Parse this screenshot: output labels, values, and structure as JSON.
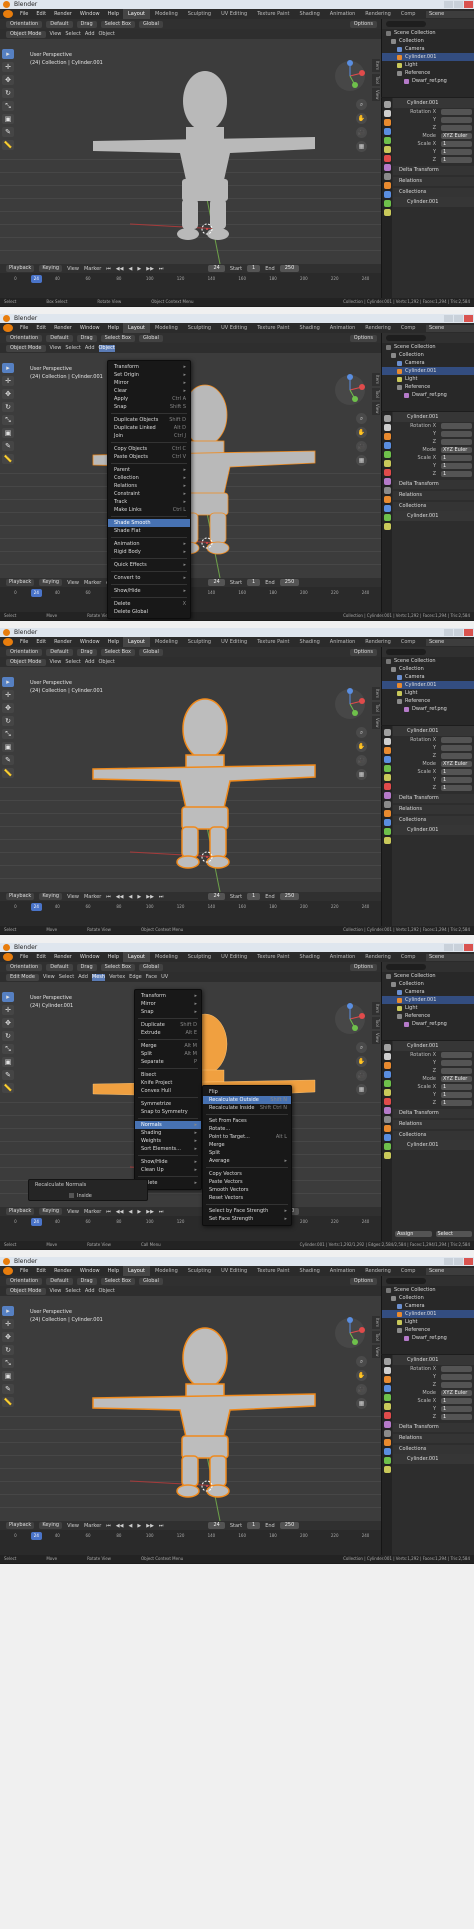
{
  "app": {
    "title": "Blender"
  },
  "menubar": {
    "items": [
      "File",
      "Edit",
      "Render",
      "Window",
      "Help"
    ],
    "workspaces": [
      "Layout",
      "Modeling",
      "Sculpting",
      "UV Editing",
      "Texture Paint",
      "Shading",
      "Animation",
      "Rendering",
      "Comp"
    ],
    "scene": "Scene"
  },
  "header": {
    "mode_object": "Object Mode",
    "mode_edit": "Edit Mode",
    "view": "View",
    "select": "Select",
    "add": "Add",
    "object": "Object",
    "mesh": "Mesh",
    "vertex": "Vertex",
    "edge": "Edge",
    "face": "Face",
    "uv": "UV",
    "orientation": "Orientation",
    "default": "Default",
    "drag": "Drag",
    "select_box": "Select Box",
    "global": "Global",
    "options": "Options"
  },
  "viewport": {
    "line1": "User Perspective",
    "line2": "(24) Collection | Cylinder.001",
    "line2_edit": "(24) Cylinder.001"
  },
  "sidetabs": [
    "Item",
    "Tool",
    "View"
  ],
  "timeline": {
    "playback": "Playback",
    "keying": "Keying",
    "view": "View",
    "marker": "Marker",
    "current": "24",
    "start_label": "Start",
    "start": "1",
    "end_label": "End",
    "end": "250",
    "ruler": [
      "0",
      "20",
      "40",
      "60",
      "80",
      "100",
      "120",
      "140",
      "160",
      "180",
      "200",
      "220",
      "240"
    ]
  },
  "status": {
    "s1": {
      "left": "Select",
      "mid1": "Box Select",
      "mid2": "Rotate View",
      "mid3": "Object Context Menu",
      "stats": "Collection | Cylinder.001 | Verts:1,292 | Faces:1,294 | Tris:2,584"
    },
    "s2": {
      "left": "Select",
      "mid1": "Move",
      "mid2": "Rotate View",
      "mid3": "Object Context Menu",
      "stats": "Collection | Cylinder.001 | Verts:1,292 | Faces:1,294 | Tris:2,584"
    },
    "s4": {
      "left": "Select",
      "mid1": "Move",
      "mid2": "Rotate View",
      "mid3": "Call Menu",
      "stats": "Cylinder.001 | Verts:1,292/1,292 | Edges:2,584/2,584 | Faces:1,294/1,294 | Tris:2,584"
    }
  },
  "outliner": {
    "rows": [
      "Scene Collection",
      "Collection",
      "Camera",
      "Cylinder.001",
      "Light",
      "Reference",
      "Dwarf_ref.png"
    ]
  },
  "properties": {
    "object_name": "Cylinder.001",
    "rows": [
      {
        "l": "Rotation X",
        "v": ""
      },
      {
        "l": "Y",
        "v": ""
      },
      {
        "l": "Z",
        "v": ""
      },
      {
        "l": "Mode",
        "v": "XYZ Euler"
      },
      {
        "l": "Scale X",
        "v": "1"
      },
      {
        "l": "Y",
        "v": "1"
      },
      {
        "l": "Z",
        "v": "1"
      }
    ],
    "delta": "Delta Transform",
    "relations": "Relations",
    "collections": "Collections",
    "obj2": "Cylinder.001",
    "assign": "Assign",
    "select": "Select"
  },
  "object_menu": {
    "items": [
      {
        "t": "Transform",
        "sc": "▸"
      },
      {
        "t": "Set Origin",
        "sc": "▸"
      },
      {
        "t": "Mirror",
        "sc": "▸"
      },
      {
        "t": "Clear",
        "sc": "▸"
      },
      {
        "t": "Apply",
        "sc": "Ctrl A"
      },
      {
        "t": "Snap",
        "sc": "Shift S"
      },
      {
        "sep": true
      },
      {
        "t": "Duplicate Objects",
        "sc": "Shift D"
      },
      {
        "t": "Duplicate Linked",
        "sc": "Alt D"
      },
      {
        "t": "Join",
        "sc": "Ctrl J"
      },
      {
        "sep": true
      },
      {
        "t": "Copy Objects",
        "sc": "Ctrl C"
      },
      {
        "t": "Paste Objects",
        "sc": "Ctrl V"
      },
      {
        "sep": true
      },
      {
        "t": "Parent",
        "sc": "▸"
      },
      {
        "t": "Collection",
        "sc": "▸"
      },
      {
        "t": "Relations",
        "sc": "▸"
      },
      {
        "t": "Constraint",
        "sc": "▸"
      },
      {
        "t": "Track",
        "sc": "▸"
      },
      {
        "t": "Make Links",
        "sc": "Ctrl L"
      },
      {
        "sep": true
      },
      {
        "t": "Shade Smooth",
        "sc": "",
        "hl": true
      },
      {
        "t": "Shade Flat",
        "sc": ""
      },
      {
        "sep": true
      },
      {
        "t": "Animation",
        "sc": "▸"
      },
      {
        "t": "Rigid Body",
        "sc": "▸"
      },
      {
        "sep": true
      },
      {
        "t": "Quick Effects",
        "sc": "▸"
      },
      {
        "sep": true
      },
      {
        "t": "Convert to",
        "sc": "▸"
      },
      {
        "sep": true
      },
      {
        "t": "Show/Hide",
        "sc": "▸"
      },
      {
        "sep": true
      },
      {
        "t": "Delete",
        "sc": "X"
      },
      {
        "t": "Delete Global",
        "sc": ""
      }
    ]
  },
  "mesh_menu": {
    "items": [
      {
        "t": "Transform",
        "sc": "▸"
      },
      {
        "t": "Mirror",
        "sc": "▸"
      },
      {
        "t": "Snap",
        "sc": "▸"
      },
      {
        "sep": true
      },
      {
        "t": "Duplicate",
        "sc": "Shift D"
      },
      {
        "t": "Extrude",
        "sc": "Alt E"
      },
      {
        "sep": true
      },
      {
        "t": "Merge",
        "sc": "Alt M"
      },
      {
        "t": "Split",
        "sc": "Alt M"
      },
      {
        "t": "Separate",
        "sc": "P"
      },
      {
        "sep": true
      },
      {
        "t": "Bisect",
        "sc": ""
      },
      {
        "t": "Knife Project",
        "sc": ""
      },
      {
        "t": "Convex Hull",
        "sc": ""
      },
      {
        "sep": true
      },
      {
        "t": "Symmetrize",
        "sc": ""
      },
      {
        "t": "Snap to Symmetry",
        "sc": ""
      },
      {
        "sep": true
      },
      {
        "t": "Normals",
        "sc": "▸",
        "hl": true
      },
      {
        "t": "Shading",
        "sc": "▸"
      },
      {
        "t": "Weights",
        "sc": "▸"
      },
      {
        "t": "Sort Elements...",
        "sc": "▸"
      },
      {
        "sep": true
      },
      {
        "t": "Show/Hide",
        "sc": "▸"
      },
      {
        "t": "Clean Up",
        "sc": "▸"
      },
      {
        "sep": true
      },
      {
        "t": "Delete",
        "sc": "▸"
      }
    ]
  },
  "normals_menu": {
    "items": [
      {
        "t": "Flip",
        "sc": ""
      },
      {
        "t": "Recalculate Outside",
        "sc": "Shift N",
        "hl": true
      },
      {
        "t": "Recalculate Inside",
        "sc": "Shift Ctrl N"
      },
      {
        "sep": true
      },
      {
        "t": "Set From Faces",
        "sc": ""
      },
      {
        "t": "Rotate...",
        "sc": ""
      },
      {
        "t": "Point to Target...",
        "sc": "Alt L"
      },
      {
        "t": "Merge",
        "sc": ""
      },
      {
        "t": "Split",
        "sc": ""
      },
      {
        "t": "Average",
        "sc": "▸"
      },
      {
        "sep": true
      },
      {
        "t": "Copy Vectors",
        "sc": ""
      },
      {
        "t": "Paste Vectors",
        "sc": ""
      },
      {
        "t": "Smooth Vectors",
        "sc": ""
      },
      {
        "t": "Reset Vectors",
        "sc": ""
      },
      {
        "sep": true
      },
      {
        "t": "Select by Face Strength",
        "sc": "▸"
      },
      {
        "t": "Set Face Strength",
        "sc": "▸"
      }
    ]
  },
  "redo_panel": {
    "title": "Recalculate Normals",
    "inside": "Inside"
  }
}
